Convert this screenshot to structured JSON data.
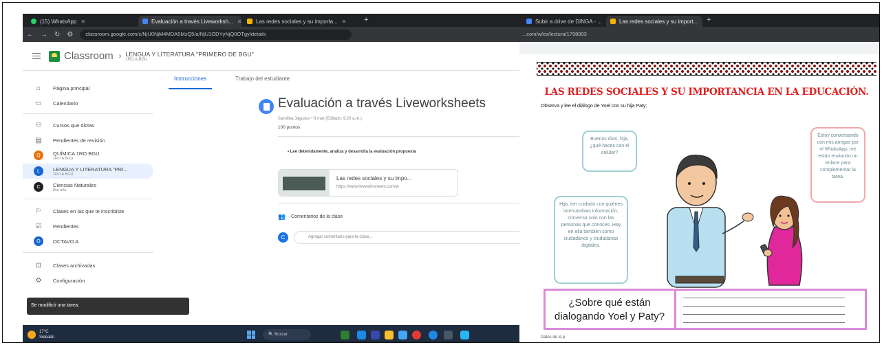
{
  "left": {
    "browser": {
      "tabs": [
        {
          "label": "(15) WhatsApp",
          "active": false
        },
        {
          "label": "Evaluación a través Liveworksh...",
          "active": true
        },
        {
          "label": "Las redes sociales y su importa...",
          "active": false
        }
      ],
      "url": "classroom.google.com/c/NjU0NjM4MDA5MzQ5/a/NjU1ODYyNjQ0OTgy/details"
    },
    "header": {
      "app_name": "Classroom",
      "course_title": "LENGUA Y LITERATURA \"PRIMERO DE BGU\"",
      "course_subtitle": "1RO A BGU"
    },
    "sidebar": {
      "items": [
        {
          "label": "Página principal",
          "icon": "home-icon"
        },
        {
          "label": "Calendario",
          "icon": "calendar-icon"
        },
        {
          "label": "Cursos que dictas",
          "icon": "people-icon"
        },
        {
          "label": "Pendientes de revisión",
          "icon": "folder-icon"
        },
        {
          "label": "QUÍMICA 1RO BGU",
          "sub": "1RO A BGU",
          "avatar": "Q",
          "color": "#e8710a"
        },
        {
          "label": "LENGUA Y LITERATURA \"PRI...",
          "sub": "1RO A BGU",
          "avatar": "L",
          "color": "#1967d2",
          "active": true
        },
        {
          "label": "Ciencias Naturales",
          "sub": "8vo año",
          "avatar": "C",
          "color": "#202124"
        },
        {
          "label": "Clases en las que te inscribiste",
          "icon": "school-icon"
        },
        {
          "label": "Pendientes",
          "icon": "checklist-icon"
        },
        {
          "label": "OCTAVO A",
          "avatar": "O",
          "color": "#1967d2"
        },
        {
          "label": "Clases archivadas",
          "icon": "archive-icon"
        },
        {
          "label": "Configuración",
          "icon": "gear-icon"
        }
      ]
    },
    "tabs": {
      "instructions": "Instrucciones",
      "student_work": "Trabajo del estudiante"
    },
    "assignment": {
      "title": "Evaluación a través Liveworksheets",
      "meta": "Carolina Jaguaco • 9 mar (Editado: 9:20 a.m.)",
      "points": "100 puntos",
      "instruction": "• Lee detenidamente, analiza y desarrolla la evaluación propuesta",
      "attachment_title": "Las redes sociales y su impo...",
      "attachment_url": "https://www.liveworksheets.com/w"
    },
    "comments": {
      "title": "Comentarios de la clase",
      "avatar": "C",
      "placeholder": "Agregar comentario para la clase..."
    },
    "snackbar": "Se modificó una tarea.",
    "taskbar": {
      "temp": "17°C",
      "weather": "Soleado",
      "search": "Buscar"
    }
  },
  "right": {
    "browser": {
      "tabs": [
        {
          "label": "Subir a drive de DINGA - ...",
          "active": false
        },
        {
          "label": "Las redes sociales y su import...",
          "active": true
        }
      ],
      "url": "...com/w/es/lectura/1798893"
    },
    "worksheet": {
      "title": "LAS REDES SOCIALES Y SU IMPORTANCIA EN LA EDUCACIÓN.",
      "instruction": "Observa y lee el diálogo de Yoel con su hija Paty:",
      "bubble_1": "Buenos días, hija, ¿qué haces con el celular?",
      "bubble_2": "Estoy conversando con mis amigas por el WhatsApp, me están enviando un enlace para complementar la tarea.",
      "bubble_3": "Hija, ten cuidado con quiénes intercambias información, conversa solo con las personas que conoces. Hay en ella también como ciudadanos y ciudadanas digitales.",
      "question": "¿Sobre qué están dialogando Yoel y Paty?",
      "footer": "Datos de la p"
    }
  }
}
